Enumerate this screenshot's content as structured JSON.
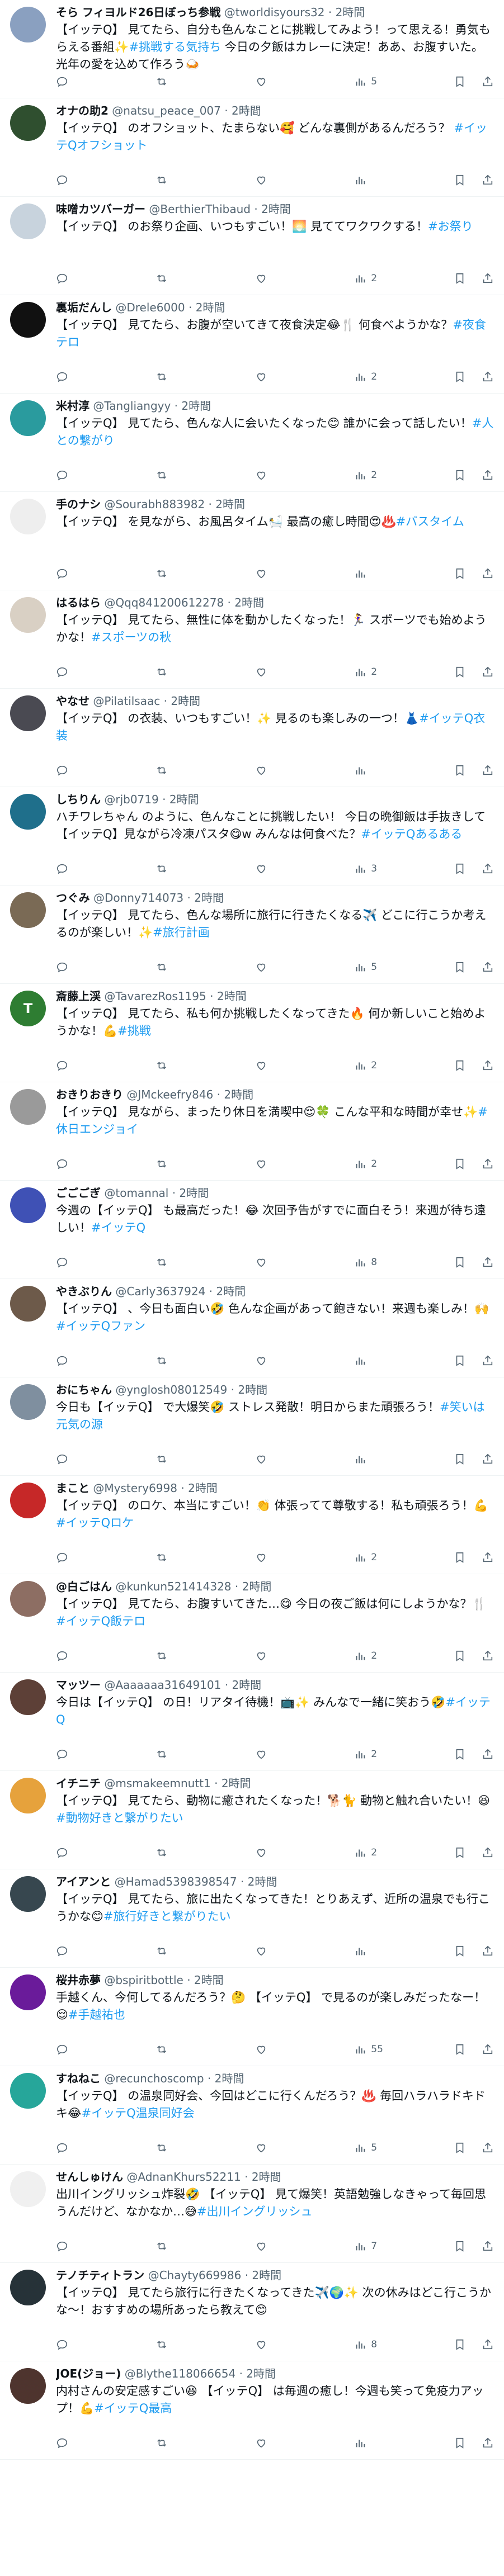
{
  "tweets": [
    {
      "name": "そら フィヨルド26日ぼっち参戦",
      "handle": "@tworldisyours32",
      "time": "2時間",
      "body": "【イッテQ】 見てたら、自分も色んなことに挑戦してみよう！って思える！勇気もらえる番組✨",
      "tag": "#挑戦する気持ち",
      "body2": " 今日の夕飯はカレーに決定！ああ、お腹すいた。光年の愛を込めて作ろう🍛",
      "views": "5",
      "avatar": "#8aa0c0",
      "initial": ""
    },
    {
      "name": "オナの助2",
      "handle": "@natsu_peace_007",
      "time": "2時間",
      "body": "【イッテQ】 のオフショット、たまらない🥰 どんな裏側があるんだろう？ ",
      "tag": "#イッテQオフショット",
      "body2": "",
      "views": "",
      "avatar": "#2f4f2f",
      "initial": ""
    },
    {
      "name": "味噌カツバーガー",
      "handle": "@BerthierThibaud",
      "time": "2時間",
      "body": "【イッテQ】 のお祭り企画、いつもすごい！🌅 見ててワクワクする！",
      "tag": "#お祭り",
      "body2": "",
      "views": "2",
      "avatar": "#c8d3dd",
      "initial": ""
    },
    {
      "name": "裏垢だんし",
      "handle": "@Drele6000",
      "time": "2時間",
      "body": "【イッテQ】 見てたら、お腹が空いてきて夜食決定😂🍴 何食べようかな？",
      "tag": "#夜食テロ",
      "body2": "",
      "views": "2",
      "avatar": "#111111",
      "initial": ""
    },
    {
      "name": "米村淳",
      "handle": "@Tangliangyy",
      "time": "2時間",
      "body": "【イッテQ】 見てたら、色んな人に会いたくなった😊 誰かに会って話したい！",
      "tag": "#人との繋がり",
      "body2": "",
      "views": "2",
      "avatar": "#2a9b9e",
      "initial": ""
    },
    {
      "name": "手のナシ",
      "handle": "@Sourabh883982",
      "time": "2時間",
      "body": "【イッテQ】 を見ながら、お風呂タイム🛀 最高の癒し時間😍♨️",
      "tag": "#バスタイム",
      "body2": "",
      "views": "",
      "avatar": "#eeeeee",
      "initial": ""
    },
    {
      "name": "はるはら",
      "handle": "@Qqq841200612278",
      "time": "2時間",
      "body": "【イッテQ】 見てたら、無性に体を動かしたくなった！🏃‍♀️ スポーツでも始めようかな！",
      "tag": "#スポーツの秋",
      "body2": "",
      "views": "2",
      "avatar": "#d9d0c4",
      "initial": ""
    },
    {
      "name": "やなせ",
      "handle": "@Pilatilsaac",
      "time": "2時間",
      "body": "【イッテQ】 の衣装、いつもすごい！✨ 見るのも楽しみの一つ！👗",
      "tag": "#イッテQ衣装",
      "body2": "",
      "views": "",
      "avatar": "#4a4a52",
      "initial": ""
    },
    {
      "name": "しちりん",
      "handle": "@rjb0719",
      "time": "2時間",
      "body": "ハチワレちゃん のように、色んなことに挑戦したい！ 今日の晩御飯は手抜きして【イッテQ】見ながら冷凍パスタ😋w みんなは何食べた？",
      "tag": "#イッテQあるある",
      "body2": "",
      "views": "3",
      "avatar": "#1f6f8b",
      "initial": ""
    },
    {
      "name": "つぐみ",
      "handle": "@Donny714073",
      "time": "2時間",
      "body": "【イッテQ】 見てたら、色んな場所に旅行に行きたくなる✈️ どこに行こうか考えるのが楽しい！✨",
      "tag": "#旅行計画",
      "body2": "",
      "views": "5",
      "avatar": "#7a6a55",
      "initial": ""
    },
    {
      "name": "斎藤上渓",
      "handle": "@TavarezRos1195",
      "time": "2時間",
      "body": "【イッテQ】 見てたら、私も何か挑戦したくなってきた🔥 何か新しいこと始めようかな！💪",
      "tag": "#挑戦",
      "body2": "",
      "views": "2",
      "avatar": "#2e7d32",
      "initial": "T"
    },
    {
      "name": "おきりおきり",
      "handle": "@JMckeefry846",
      "time": "2時間",
      "body": "【イッテQ】 見ながら、まったり休日を満喫中😌🍀 こんな平和な時間が幸せ✨",
      "tag": "#休日エンジョイ",
      "body2": "",
      "views": "2",
      "avatar": "#9a9a9a",
      "initial": ""
    },
    {
      "name": "ごごごぎ",
      "handle": "@tomannal",
      "time": "2時間",
      "body": "今週の【イッテQ】 も最高だった！😂 次回予告がすでに面白そう！来週が待ち遠しい！",
      "tag": "#イッテQ",
      "body2": "",
      "views": "8",
      "avatar": "#3f51b5",
      "initial": ""
    },
    {
      "name": "やきぶりん",
      "handle": "@Carly3637924",
      "time": "2時間",
      "body": "【イッテQ】 、今日も面白い🤣 色んな企画があって飽きない！来週も楽しみ！🙌",
      "tag": "#イッテQファン",
      "body2": "",
      "views": "",
      "avatar": "#6d5a4a",
      "initial": ""
    },
    {
      "name": "おにちゃん",
      "handle": "@ynglosh08012549",
      "time": "2時間",
      "body": "今日も【イッテQ】 で大爆笑🤣 ストレス発散！明日からまた頑張ろう！",
      "tag": "#笑いは元気の源",
      "body2": "",
      "views": "",
      "avatar": "#7f8f9f",
      "initial": ""
    },
    {
      "name": "まこと",
      "handle": "@Mystery6998",
      "time": "2時間",
      "body": "【イッテQ】 のロケ、本当にすごい！👏 体張ってて尊敬する！私も頑張ろう！💪",
      "tag": "#イッテQロケ",
      "body2": "",
      "views": "2",
      "avatar": "#c62828",
      "initial": ""
    },
    {
      "name": "@白ごはん",
      "handle": "@kunkun521414328",
      "time": "2時間",
      "body": "【イッテQ】 見てたら、お腹すいてきた…😋 今日の夜ご飯は何にしようかな？🍴",
      "tag": "#イッテQ飯テロ",
      "body2": "",
      "views": "2",
      "avatar": "#8d6e63",
      "initial": ""
    },
    {
      "name": "マッツー",
      "handle": "@Aaaaaaa31649101",
      "time": "2時間",
      "body": "今日は【イッテQ】 の日！リアタイ待機！📺✨ みんなで一緒に笑おう🤣",
      "tag": "#イッテQ",
      "body2": "",
      "views": "2",
      "avatar": "#5d4037",
      "initial": ""
    },
    {
      "name": "イチニチ",
      "handle": "@msmakeemnutt1",
      "time": "2時間",
      "body": "【イッテQ】 見てたら、動物に癒されたくなった！🐕🐈 動物と触れ合いたい！😆",
      "tag": "#動物好きと繋がりたい",
      "body2": "",
      "views": "2",
      "avatar": "#e6a23c",
      "initial": ""
    },
    {
      "name": "アイアンと",
      "handle": "@Hamad5398398547",
      "time": "2時間",
      "body": "【イッテQ】 見てたら、旅に出たくなってきた！とりあえず、近所の温泉でも行こうかな😊",
      "tag": "#旅行好きと繋がりたい",
      "body2": "",
      "views": "",
      "avatar": "#37474f",
      "initial": ""
    },
    {
      "name": "桜井赤夢",
      "handle": "@bspiritbottle",
      "time": "2時間",
      "body": "手越くん、今何してるんだろう？🤔 【イッテQ】 で見るのが楽しみだったなー！😌",
      "tag": "#手越祐也",
      "body2": "",
      "views": "55",
      "avatar": "#6a1b9a",
      "initial": ""
    },
    {
      "name": "すねねこ",
      "handle": "@recunchoscomp",
      "time": "2時間",
      "body": "【イッテQ】 の温泉同好会、今回はどこに行くんだろう？♨️ 毎回ハラハラドキドキ😂",
      "tag": "#イッテQ温泉同好会",
      "body2": "",
      "views": "5",
      "avatar": "#26a69a",
      "initial": ""
    },
    {
      "name": "せんしゅけん",
      "handle": "@AdnanKhurs52211",
      "time": "2時間",
      "body": "出川イングリッシュ炸裂🤣 【イッテQ】 見て爆笑！英語勉強しなきゃって毎回思うんだけど、なかなか…😅",
      "tag": "#出川イングリッシュ",
      "body2": "",
      "views": "7",
      "avatar": "#f0f0f0",
      "initial": ""
    },
    {
      "name": "テノチティトラン",
      "handle": "@Chayty669986",
      "time": "2時間",
      "body": "【イッテQ】 見てたら旅行に行きたくなってきた✈️🌍✨ 次の休みはどこ行こうかな～！おすすめの場所あったら教えて😊",
      "tag": "",
      "body2": "",
      "views": "8",
      "avatar": "#263238",
      "initial": ""
    },
    {
      "name": "JOE(ジョー)",
      "handle": "@Blythe118066654",
      "time": "2時間",
      "body": "内村さんの安定感すごい😆 【イッテQ】 は毎週の癒し！今週も笑って免疫力アップ！💪",
      "tag": "#イッテQ最高",
      "body2": "",
      "views": "",
      "avatar": "#4e342e",
      "initial": ""
    }
  ],
  "icons": [
    "reply-icon",
    "retweet-icon",
    "like-icon",
    "views-icon",
    "bookmark-icon",
    "share-icon"
  ]
}
